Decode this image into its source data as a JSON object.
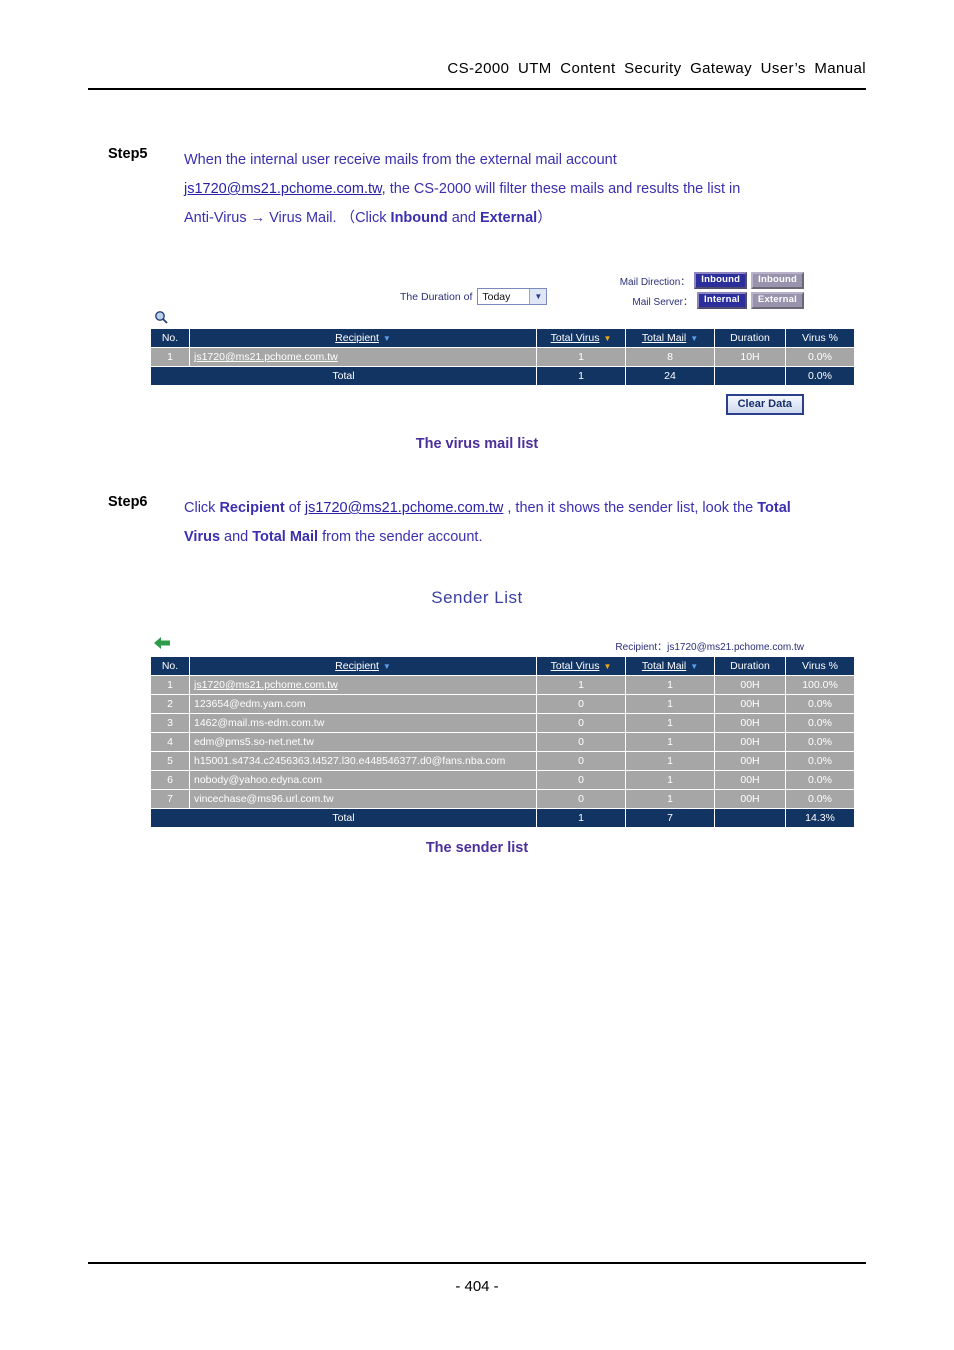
{
  "header": {
    "title": "CS-2000 UTM Content Security Gateway User’s Manual"
  },
  "footer": {
    "page_number": "- 404 -"
  },
  "steps": [
    {
      "label": "Step5",
      "line1": "When the internal user receive mails from the external mail account",
      "line2_link": "js1720@ms21.pchome.com.tw",
      "line2_rest": ", the CS-2000 will filter these mails and results the list in",
      "line3_pre": "Anti-Virus → Virus Mail. （Click ",
      "line3_b1": "Inbound",
      "line3_mid": " and ",
      "line3_b2": "External",
      "line3_post": "）"
    },
    {
      "label": "Step6",
      "line1_pre": "Click ",
      "line1_b1": "Recipient",
      "line1_mid": " of ",
      "line1_link": "js1720@ms21.pchome.com.tw",
      "line1_post": " , then it shows the sender list, look the ",
      "line1_b2": "Total",
      "line2_b1": "Virus",
      "line2_mid": " and ",
      "line2_b2": "Total Mail",
      "line2_post": " from the sender account."
    }
  ],
  "captions": {
    "figure1": "The virus mail list",
    "figure2": "The sender list"
  },
  "virus_mail_panel": {
    "duration_label": "The Duration of",
    "duration_value": "Today",
    "mail_direction_label": "Mail Direction：",
    "mail_direction_buttons": [
      {
        "label": "Inbound",
        "selected": true
      },
      {
        "label": "Inbound",
        "selected": false
      }
    ],
    "mail_server_label": "Mail Server：",
    "mail_server_buttons": [
      {
        "label": "Internal",
        "selected": true
      },
      {
        "label": "External",
        "selected": false
      }
    ],
    "search_icon": "magnifier-icon",
    "columns": [
      "No.",
      "Recipient",
      "Total Virus",
      "Total Mail",
      "Duration",
      "Virus %"
    ],
    "sort_arrows": {
      "recipient": "blue",
      "total_virus": "orange",
      "total_mail": "blue"
    },
    "rows": [
      {
        "no": "1",
        "recipient": "js1720@ms21.pchome.com.tw",
        "total_virus": "1",
        "total_mail": "8",
        "duration": "10H",
        "virus_pct": "0.0%"
      }
    ],
    "total_row": {
      "label": "Total",
      "total_virus": "1",
      "total_mail": "24",
      "duration": "",
      "virus_pct": "0.0%"
    },
    "clear_data_button": "Clear Data"
  },
  "sender_list_panel": {
    "title": "Sender List",
    "back_icon": "back-arrow-icon",
    "recipient_note_label": "Recipient：",
    "recipient_note_value": "js1720@ms21.pchome.com.tw",
    "columns": [
      "No.",
      "Recipient",
      "Total Virus",
      "Total Mail",
      "Duration",
      "Virus %"
    ],
    "rows": [
      {
        "no": "1",
        "recipient": "js1720@ms21.pchome.com.tw",
        "total_virus": "1",
        "total_mail": "1",
        "duration": "00H",
        "virus_pct": "100.0%"
      },
      {
        "no": "2",
        "recipient": "123654@edm.yam.com",
        "total_virus": "0",
        "total_mail": "1",
        "duration": "00H",
        "virus_pct": "0.0%"
      },
      {
        "no": "3",
        "recipient": "1462@mail.ms-edm.com.tw",
        "total_virus": "0",
        "total_mail": "1",
        "duration": "00H",
        "virus_pct": "0.0%"
      },
      {
        "no": "4",
        "recipient": "edm@pms5.so-net.net.tw",
        "total_virus": "0",
        "total_mail": "1",
        "duration": "00H",
        "virus_pct": "0.0%"
      },
      {
        "no": "5",
        "recipient": "h15001.s4734.c2456363.t4527.l30.e448546377.d0@fans.nba.com",
        "total_virus": "0",
        "total_mail": "1",
        "duration": "00H",
        "virus_pct": "0.0%"
      },
      {
        "no": "6",
        "recipient": "nobody@yahoo.edyna.com",
        "total_virus": "0",
        "total_mail": "1",
        "duration": "00H",
        "virus_pct": "0.0%"
      },
      {
        "no": "7",
        "recipient": "vincechase@ms96.url.com.tw",
        "total_virus": "0",
        "total_mail": "1",
        "duration": "00H",
        "virus_pct": "0.0%"
      }
    ],
    "total_row": {
      "label": "Total",
      "total_virus": "1",
      "total_mail": "7",
      "duration": "",
      "virus_pct": "14.3%"
    }
  },
  "colors": {
    "header_blue": "#123463",
    "row_gray": "#a6a6a6",
    "link_purple": "#3b2fb0",
    "caption_purple": "#4b2f9b"
  }
}
